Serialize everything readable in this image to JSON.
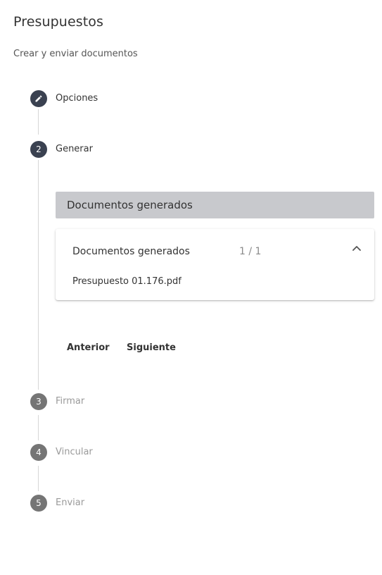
{
  "header": {
    "title": "Presupuestos",
    "subtitle": "Crear y enviar documentos"
  },
  "steps": [
    {
      "number": "",
      "label": "Opciones",
      "state": "edit",
      "icon": "pencil-icon"
    },
    {
      "number": "2",
      "label": "Generar",
      "state": "active"
    },
    {
      "number": "3",
      "label": "Firmar",
      "state": "inactive"
    },
    {
      "number": "4",
      "label": "Vincular",
      "state": "inactive"
    },
    {
      "number": "5",
      "label": "Enviar",
      "state": "inactive"
    }
  ],
  "generate": {
    "section_title": "Documentos generados",
    "panel": {
      "title": "Documentos generados",
      "count": "1 / 1",
      "expanded": true,
      "files": [
        "Presupuesto 01.176.pdf"
      ]
    },
    "buttons": {
      "previous": "Anterior",
      "next": "Siguiente"
    }
  },
  "colors": {
    "step_active": "#3a4150",
    "step_inactive": "#757575",
    "section_bar": "#c8c9cd"
  }
}
